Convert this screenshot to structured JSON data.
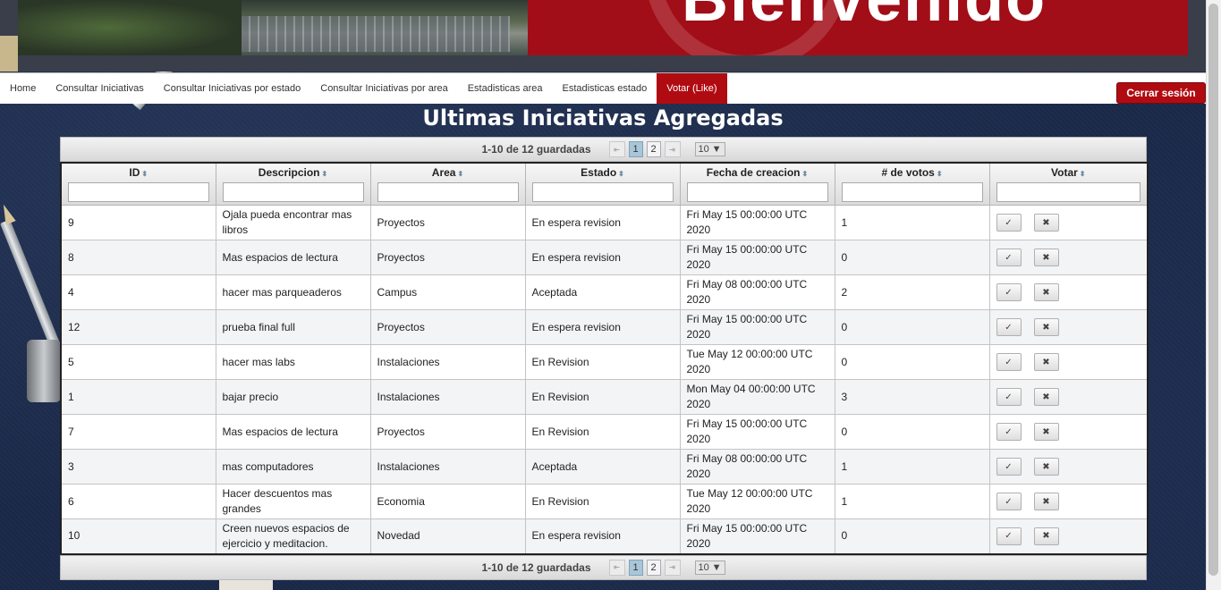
{
  "banner": {
    "title": "Bienvenido"
  },
  "nav": {
    "items": [
      {
        "label": "Home"
      },
      {
        "label": "Consultar Iniciativas"
      },
      {
        "label": "Consultar Iniciativas por estado"
      },
      {
        "label": "Consultar Iniciativas por area"
      },
      {
        "label": "Estadisticas area"
      },
      {
        "label": "Estadisticas estado"
      },
      {
        "label": "Votar (Like)",
        "active": true
      }
    ],
    "logout": "Cerrar sesión"
  },
  "page": {
    "title": "Ultimas Iniciativas Agregadas"
  },
  "paginator": {
    "summary": "1-10 de 12 guardadas",
    "pages": [
      "1",
      "2"
    ],
    "current_page": "1",
    "rows_per_page": "10",
    "first_icon": "first-page-icon",
    "last_icon": "last-page-icon"
  },
  "table": {
    "columns": [
      "ID",
      "Descripcion",
      "Area",
      "Estado",
      "Fecha de creacion",
      "# de votos",
      "Votar"
    ],
    "rows": [
      [
        "9",
        "Ojala pueda encontrar mas libros",
        "Proyectos",
        "En espera revision",
        "Fri May 15 00:00:00 UTC 2020",
        "1"
      ],
      [
        "8",
        "Mas espacios de lectura",
        "Proyectos",
        "En espera revision",
        "Fri May 15 00:00:00 UTC 2020",
        "0"
      ],
      [
        "4",
        "hacer mas parqueaderos",
        "Campus",
        "Aceptada",
        "Fri May 08 00:00:00 UTC 2020",
        "2"
      ],
      [
        "12",
        "prueba final full",
        "Proyectos",
        "En espera revision",
        "Fri May 15 00:00:00 UTC 2020",
        "0"
      ],
      [
        "5",
        "hacer mas labs",
        "Instalaciones",
        "En Revision",
        "Tue May 12 00:00:00 UTC 2020",
        "0"
      ],
      [
        "1",
        "bajar precio",
        "Instalaciones",
        "En Revision",
        "Mon May 04 00:00:00 UTC 2020",
        "3"
      ],
      [
        "7",
        "Mas espacios de lectura",
        "Proyectos",
        "En Revision",
        "Fri May 15 00:00:00 UTC 2020",
        "0"
      ],
      [
        "3",
        "mas computadores",
        "Instalaciones",
        "Aceptada",
        "Fri May 08 00:00:00 UTC 2020",
        "1"
      ],
      [
        "6",
        "Hacer descuentos mas grandes",
        "Economia",
        "En Revision",
        "Tue May 12 00:00:00 UTC 2020",
        "1"
      ],
      [
        "10",
        "Creen nuevos espacios de ejercicio y meditacion.",
        "Novedad",
        "En espera revision",
        "Fri May 15 00:00:00 UTC 2020",
        "0"
      ]
    ],
    "vote_up_icon": "check-icon",
    "vote_down_icon": "close-icon"
  },
  "colors": {
    "brand_red": "#b10b12",
    "background_navy": "#1c2b4a",
    "active_page": "#a8c6d8"
  }
}
